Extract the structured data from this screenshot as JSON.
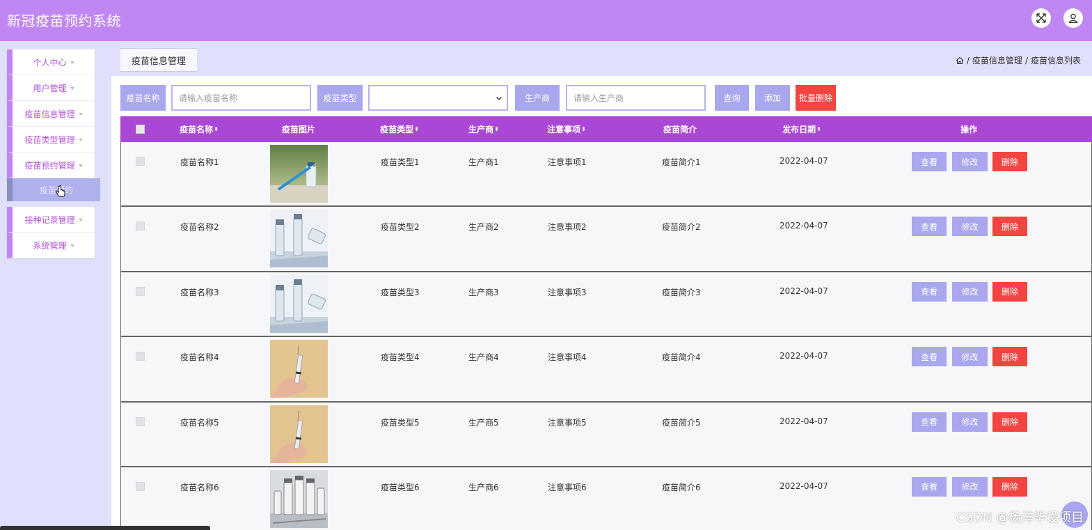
{
  "header": {
    "title": "新冠疫苗预约系统"
  },
  "colors": {
    "header": "#c087f3",
    "table_header": "#ab47d7",
    "accent_button": "#a9a7ee",
    "danger_button": "#f24541",
    "page_bg": "#e0e0fa"
  },
  "sidebar": {
    "items": [
      {
        "label": "个人中心"
      },
      {
        "label": "用户管理"
      },
      {
        "label": "疫苗信息管理"
      },
      {
        "label": "疫苗类型管理"
      },
      {
        "label": "疫苗预约管理"
      },
      {
        "label": "接种记录管理"
      },
      {
        "label": "系统管理"
      }
    ],
    "active_sub": "疫苗预约"
  },
  "tab": {
    "label": "疫苗信息管理"
  },
  "breadcrumb": {
    "level1": "疫苗信息管理",
    "level2": "疫苗信息列表",
    "sep": "/"
  },
  "search": {
    "name_label": "疫苗名称",
    "name_placeholder": "请输入疫苗名称",
    "type_label": "疫苗类型",
    "type_value": "",
    "maker_label": "生产商",
    "maker_placeholder": "请输入生产商",
    "query_button": "查询",
    "add_button": "添加",
    "batch_delete_button": "批量删除"
  },
  "table": {
    "columns": [
      "疫苗名称",
      "疫苗图片",
      "疫苗类型",
      "生产商",
      "注意事项",
      "疫苗简介",
      "发布日期",
      "操作"
    ],
    "sort_glyph": "⬍",
    "actions": {
      "view": "查看",
      "edit": "修改",
      "delete": "删除"
    },
    "rows": [
      {
        "name": "疫苗名称1",
        "image": "vaccine-syringe-vial",
        "type": "疫苗类型1",
        "maker": "生产商1",
        "notes": "注意事项1",
        "intro": "疫苗简介1",
        "date": "2022-04-07"
      },
      {
        "name": "疫苗名称2",
        "image": "vaccine-vials-blue",
        "type": "疫苗类型2",
        "maker": "生产商2",
        "notes": "注意事项2",
        "intro": "疫苗简介2",
        "date": "2022-04-07"
      },
      {
        "name": "疫苗名称3",
        "image": "vaccine-vials-blue",
        "type": "疫苗类型3",
        "maker": "生产商3",
        "notes": "注意事项3",
        "intro": "疫苗简介3",
        "date": "2022-04-07"
      },
      {
        "name": "疫苗名称4",
        "image": "hand-holding-syringe",
        "type": "疫苗类型4",
        "maker": "生产商4",
        "notes": "注意事项4",
        "intro": "疫苗简介4",
        "date": "2022-04-07"
      },
      {
        "name": "疫苗名称5",
        "image": "hand-holding-syringe",
        "type": "疫苗类型5",
        "maker": "生产商5",
        "notes": "注意事项5",
        "intro": "疫苗简介5",
        "date": "2022-04-07"
      },
      {
        "name": "疫苗名称6",
        "image": "vaccine-vials-row",
        "type": "疫苗类型6",
        "maker": "生产商6",
        "notes": "注意事项6",
        "intro": "疫苗简介6",
        "date": "2022-04-07"
      }
    ]
  },
  "watermark": "CSDN @杨洋毕设项目"
}
